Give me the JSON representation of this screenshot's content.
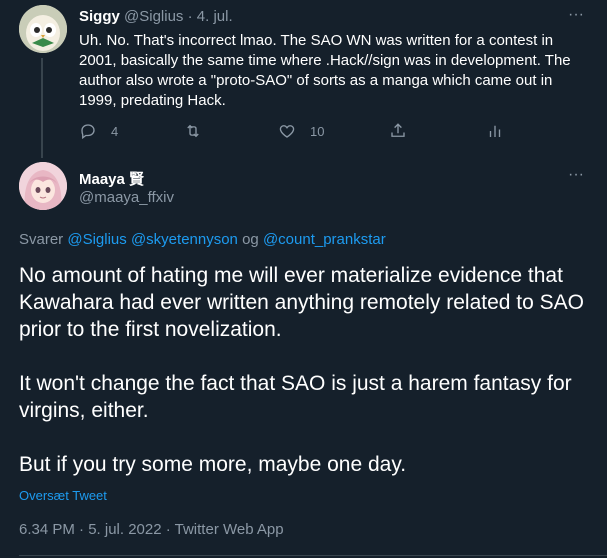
{
  "parent_tweet": {
    "name": "Siggy",
    "handle": "@Siglius",
    "separator": "·",
    "date": "4. jul.",
    "text": "Uh. No. That's incorrect lmao. The SAO WN was written for a contest in 2001, basically the same time where .Hack//sign was in development. The author also wrote a \"proto-SAO\" of sorts as a manga which came out in 1999, predating Hack.",
    "reply_count": "4",
    "like_count": "10",
    "more_glyph": "···"
  },
  "main_tweet": {
    "name": "Maaya 賢",
    "handle": "@maaya_ffxiv",
    "replying_prefix": "Svarer",
    "mention_1": "@Siglius",
    "mention_2": "@skyetennyson",
    "replying_conj": "og",
    "mention_3": "@count_prankstar",
    "paragraphs": [
      "No amount of hating me will ever materialize evidence that Kawahara had ever written anything remotely related to SAO prior to the first novelization.",
      "It won't change the fact that SAO is just a harem fantasy for virgins, either.",
      "But if you try some more, maybe one day."
    ],
    "translate_label": "Oversæt Tweet",
    "timestamp": "6.34 PM · 5. jul. 2022 · Twitter Web App",
    "more_glyph": "···"
  },
  "colors": {
    "background": "#15202b",
    "secondary_text": "#8b98a5",
    "accent": "#1d9bf0",
    "divider": "#38444d"
  }
}
